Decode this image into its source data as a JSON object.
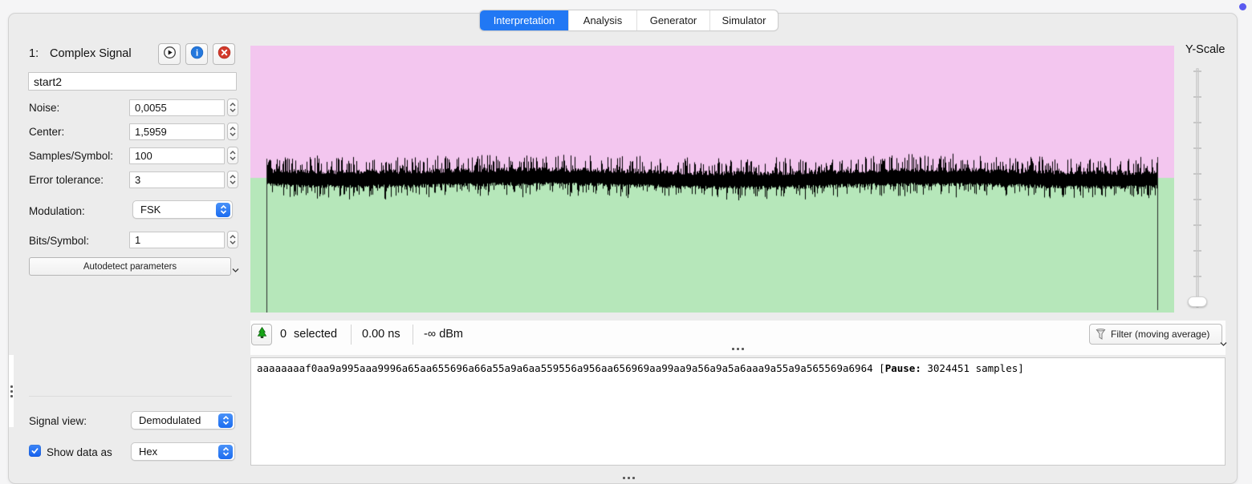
{
  "indicator_color": "#5a5af0",
  "tabs": {
    "items": [
      {
        "label": "Interpretation"
      },
      {
        "label": "Analysis"
      },
      {
        "label": "Generator"
      },
      {
        "label": "Simulator"
      }
    ],
    "selected_index": 0,
    "selected_color": "#2178f4"
  },
  "signal_panel": {
    "index_label": "1:",
    "title": "Complex Signal",
    "name_value": "start2",
    "fields": [
      {
        "label": "Noise:",
        "value": "0,0055"
      },
      {
        "label": "Center:",
        "value": "1,5959"
      },
      {
        "label": "Samples/Symbol:",
        "value": "100"
      },
      {
        "label": "Error tolerance:",
        "value": "3"
      }
    ],
    "modulation_label": "Modulation:",
    "modulation_value": "FSK",
    "bits_label": "Bits/Symbol:",
    "bits_value": "1",
    "autodetect_label": "Autodetect parameters",
    "signal_view_label": "Signal view:",
    "signal_view_value": "Demodulated",
    "show_data_label": "Show data as",
    "show_data_value": "Hex",
    "show_data_checked": true
  },
  "plot": {
    "top_color": "#f3c6ef",
    "bottom_color": "#b6e7ba",
    "wave_color": "#000000",
    "boundary_line_color": "#2a2a2a",
    "yscale_label": "Y-Scale"
  },
  "statusbar": {
    "selected_count": "0",
    "selected_label": "selected",
    "duration": "0.00 ns",
    "power": "-∞ dBm",
    "filter_label": "Filter (moving average)"
  },
  "hexview": {
    "data": "aaaaaaaaf0aa9a995aaa9996a65aa655696a66a55a9a6aa559556a956aa656969aa99aa9a56a9a5a6aaa9a55a9a565569a6964",
    "bracket": " [",
    "pause_label": "Pause:",
    "pause_rest": " 3024451 samples]"
  }
}
